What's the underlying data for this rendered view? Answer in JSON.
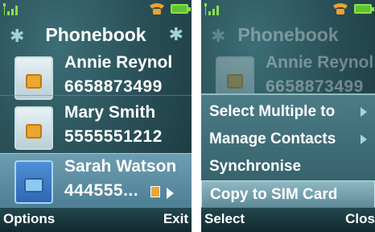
{
  "left": {
    "header": {
      "title": "Phonebook"
    },
    "contacts": [
      {
        "name": "Annie Reynol",
        "number": "6658873499"
      },
      {
        "name": "Mary Smith",
        "number": "5555551212"
      },
      {
        "name": "Sarah Watson",
        "number": "444555..."
      }
    ],
    "softkeys": {
      "left": "Options",
      "right": "Exit"
    }
  },
  "right": {
    "header": {
      "title": "Phonebook"
    },
    "contacts": [
      {
        "name": "Annie Reynol",
        "number": "6658873499"
      }
    ],
    "menu": [
      {
        "label": "Select Multiple to"
      },
      {
        "label": "Manage Contacts"
      },
      {
        "label": "Synchronise"
      },
      {
        "label": "Copy to SIM Card"
      }
    ],
    "softkeys": {
      "left": "Select",
      "right": "Clos"
    }
  },
  "colors": {
    "accent": "#5fc234",
    "sim": "#e8a733",
    "selection": "#6d9db0"
  },
  "icons": [
    "signal-icon",
    "battery-icon",
    "phone-icon",
    "star-icon",
    "gear-icon",
    "sim-card-icon",
    "chevron-right-icon"
  ]
}
